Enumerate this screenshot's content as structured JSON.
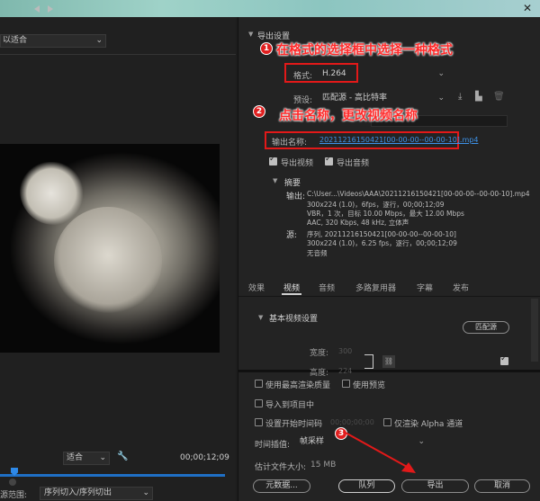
{
  "window": {
    "close_glyph": "✕"
  },
  "left": {
    "fit_select": "适合",
    "fit_select_prefix": "以适合",
    "transport_fit": "适合",
    "timecode": "00;00;12;09",
    "source_range_label": "源范围:",
    "source_range_value": "序列切入/序列切出"
  },
  "export_settings": {
    "title": "导出设置",
    "format_label": "格式:",
    "format_value": "H.264",
    "preset_label": "预设:",
    "preset_value": "匹配源 - 高比特率",
    "output_name_label": "输出名称:",
    "output_name_value": "20211216150421[00-00-00--00-00-10].mp4",
    "export_video_label": "导出视频",
    "export_audio_label": "导出音频",
    "export_video_checked": true,
    "export_audio_checked": true
  },
  "summary": {
    "title": "摘要",
    "output_key": "输出:",
    "output_lines": [
      "C:\\User...\\Videos\\AAA\\20211216150421[00-00-00--00-00-10].mp4",
      "300x224 (1.0)，6fps，逐行，00;00;12;09",
      "VBR，1 次，目标 10.00 Mbps，最大 12.00 Mbps",
      "AAC, 320 Kbps, 48 kHz, 立体声"
    ],
    "source_key": "源:",
    "source_lines": [
      "序列, 20211216150421[00-00-00--00-00-10]",
      "300x224 (1.0)，6.25 fps，逐行，00;00;12;09",
      "无音频"
    ]
  },
  "tabs": [
    {
      "label": "效果",
      "active": false
    },
    {
      "label": "视频",
      "active": true
    },
    {
      "label": "音频",
      "active": false
    },
    {
      "label": "多路复用器",
      "active": false
    },
    {
      "label": "字幕",
      "active": false
    },
    {
      "label": "发布",
      "active": false
    }
  ],
  "basic_video": {
    "title": "基本视频设置",
    "match_source_label": "匹配源",
    "width_label": "宽度:",
    "width_value": "300",
    "height_label": "高度:",
    "height_value": "224"
  },
  "options": {
    "max_quality_label": "使用最高渲染质量",
    "use_preview_label": "使用预览",
    "import_project_label": "导入到项目中",
    "start_tc_label": "设置开始时间码",
    "start_tc_value": "00;00;00;00",
    "alpha_label": "仅渲染 Alpha 通道",
    "interp_label": "时间插值:",
    "interp_value": "帧采样",
    "filesize_label": "估计文件大小:",
    "filesize_value": "15 MB"
  },
  "buttons": {
    "metadata": "元数据...",
    "queue": "队列",
    "export": "导出",
    "cancel": "取消"
  },
  "annotations": {
    "badge_1": "1",
    "text_1": "在格式的选择框中选择一种格式",
    "badge_2": "2",
    "text_2": "点击名称，更改视频名称",
    "badge_3": "3",
    "color": "#e21919"
  },
  "colors": {
    "accent_blue": "#3d92e8",
    "timeline_blue": "#1f6fc5",
    "highlight_red": "#e21919"
  }
}
